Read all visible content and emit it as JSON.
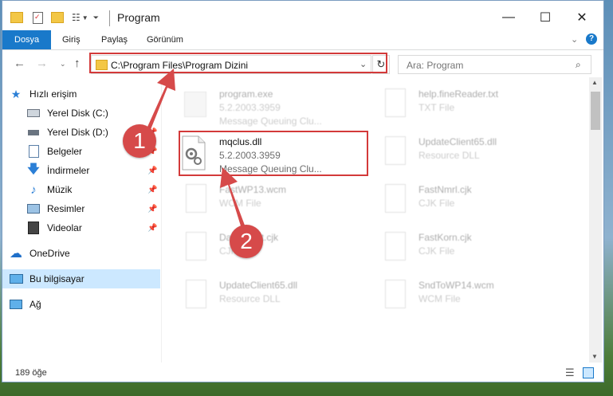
{
  "window": {
    "title": "Program",
    "controls": {
      "minimize": "—",
      "maximize": "☐",
      "close": "✕"
    }
  },
  "ribbon": {
    "tabs": [
      {
        "label": "Dosya",
        "active": true
      },
      {
        "label": "Giriş",
        "active": false
      },
      {
        "label": "Paylaş",
        "active": false
      },
      {
        "label": "Görünüm",
        "active": false
      }
    ]
  },
  "address": {
    "path": "C:\\Program Files\\Program Dizini",
    "search_placeholder": "Ara: Program"
  },
  "sidebar": {
    "items": [
      {
        "label": "Hızlı erişim",
        "icon": "star-icon"
      },
      {
        "label": "Yerel Disk (C:)",
        "icon": "drive-icon"
      },
      {
        "label": "Yerel Disk (D:)",
        "icon": "drive-icon"
      },
      {
        "label": "Belgeler",
        "icon": "document-icon"
      },
      {
        "label": "İndirmeler",
        "icon": "download-icon"
      },
      {
        "label": "Müzik",
        "icon": "music-icon"
      },
      {
        "label": "Resimler",
        "icon": "pictures-icon"
      },
      {
        "label": "Videolar",
        "icon": "video-icon"
      },
      {
        "label": "OneDrive",
        "icon": "cloud-icon"
      },
      {
        "label": "Bu bilgisayar",
        "icon": "computer-icon"
      },
      {
        "label": "Ağ",
        "icon": "network-icon"
      }
    ]
  },
  "files": [
    {
      "name": "program.exe",
      "line2": "5.2.2003.3959",
      "line3": "Message Queuing Clu..."
    },
    {
      "name": "help.fineReader.txt",
      "line2": "TXT File",
      "line3": ""
    },
    {
      "name": "mqclus.dll",
      "line2": "5.2.2003.3959",
      "line3": "Message Queuing Clu..."
    },
    {
      "name": "UpdateClient65.dll",
      "line2": "Resource DLL",
      "line3": ""
    },
    {
      "name": "FastWP13.wcm",
      "line2": "WCM File",
      "line3": ""
    },
    {
      "name": "FastNmrl.cjk",
      "line2": "CJK File",
      "line3": ""
    },
    {
      "name": "DataClient.cjk",
      "line2": "CJK File",
      "line3": ""
    },
    {
      "name": "FastKorn.cjk",
      "line2": "CJK File",
      "line3": ""
    },
    {
      "name": "UpdateClient65.dll",
      "line2": "Resource DLL",
      "line3": ""
    },
    {
      "name": "SndToWP14.wcm",
      "line2": "WCM File",
      "line3": ""
    }
  ],
  "status": {
    "count": "189 öğe"
  },
  "annotations": {
    "step1": "1",
    "step2": "2",
    "color": "#d64a4a"
  }
}
